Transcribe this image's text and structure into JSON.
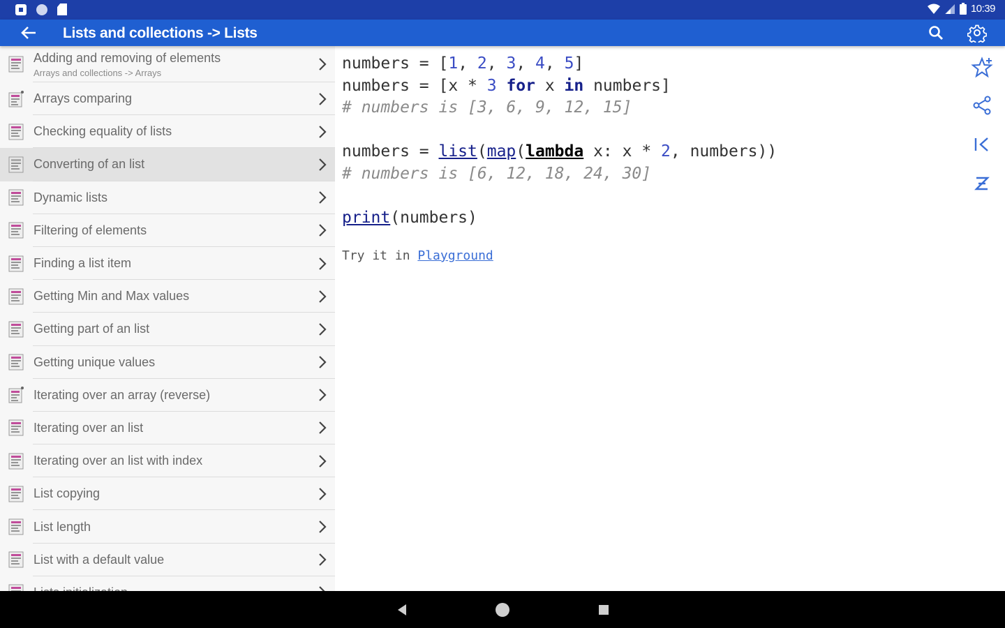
{
  "status_bar": {
    "time": "10:39"
  },
  "app_bar": {
    "title": "Lists and collections -> Lists"
  },
  "sidebar": {
    "items": [
      {
        "label": "Adding and removing of elements",
        "sublabel": "Arrays and collections -> Arrays",
        "starred": false,
        "selected": false
      },
      {
        "label": "Arrays comparing",
        "sublabel": "",
        "starred": true,
        "selected": false
      },
      {
        "label": "Checking equality of lists",
        "sublabel": "",
        "starred": false,
        "selected": false
      },
      {
        "label": "Converting of an list",
        "sublabel": "",
        "starred": false,
        "selected": true
      },
      {
        "label": "Dynamic lists",
        "sublabel": "",
        "starred": false,
        "selected": false
      },
      {
        "label": "Filtering of elements",
        "sublabel": "",
        "starred": false,
        "selected": false
      },
      {
        "label": "Finding a list item",
        "sublabel": "",
        "starred": false,
        "selected": false
      },
      {
        "label": "Getting Min and Max values",
        "sublabel": "",
        "starred": false,
        "selected": false
      },
      {
        "label": "Getting part of an list",
        "sublabel": "",
        "starred": false,
        "selected": false
      },
      {
        "label": "Getting unique values",
        "sublabel": "",
        "starred": false,
        "selected": false
      },
      {
        "label": "Iterating over an array (reverse)",
        "sublabel": "",
        "starred": true,
        "selected": false
      },
      {
        "label": "Iterating over an list",
        "sublabel": "",
        "starred": false,
        "selected": false
      },
      {
        "label": "Iterating over an list with index",
        "sublabel": "",
        "starred": false,
        "selected": false
      },
      {
        "label": "List copying",
        "sublabel": "",
        "starred": false,
        "selected": false
      },
      {
        "label": "List length",
        "sublabel": "",
        "starred": false,
        "selected": false
      },
      {
        "label": "List with a default value",
        "sublabel": "",
        "starred": false,
        "selected": false
      },
      {
        "label": "Lists initialization",
        "sublabel": "",
        "starred": false,
        "selected": false
      }
    ]
  },
  "code": {
    "l1_var": "numbers",
    "l1_op": " = [",
    "n1": "1",
    "n2": "2",
    "n3": "3",
    "n4": "4",
    "n5": "5",
    "l1_end": "]",
    "l2_var": "numbers",
    "l2_op": " = [x * ",
    "l2_n": "3",
    "l2_for": "for",
    "l2_x": " x ",
    "l2_in": "in",
    "l2_end": " numbers]",
    "l3_comment": "# numbers is [3, 6, 9, 12, 15]",
    "l5_var": "numbers",
    "l5_op": " = ",
    "l5_list": "list",
    "l5_map": "map",
    "l5_lambda": "lambda",
    "l5_mid": " x: x * ",
    "l5_n": "2",
    "l5_end": ", numbers))",
    "l6_comment": "# numbers is [6, 12, 18, 24, 30]",
    "l8_print": "print",
    "l8_end": "(numbers)",
    "try_text": "Try it in ",
    "try_link": "Playground"
  },
  "colors": {
    "status_bar": "#1d3fa8",
    "app_bar": "#1f5fd1",
    "accent_icon": "#3a6ed6",
    "selected_row": "#e2e2e2"
  }
}
